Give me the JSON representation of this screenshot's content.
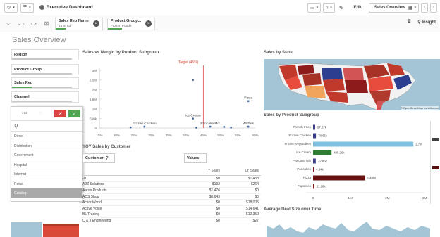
{
  "toolbar": {
    "app_title": "Executive Dashboard",
    "edit_label": "Edit",
    "sheet_selector": "Sales Overview"
  },
  "selections": {
    "chips": [
      {
        "title": "Sales Rep Name",
        "value": "14 of 63"
      },
      {
        "title": "Product Group...",
        "value": "Frozen Foods"
      }
    ],
    "insights_label": "Insight"
  },
  "sheet": {
    "title": "Sales Overview"
  },
  "filters": {
    "region": "Region",
    "product_group": "Product Group",
    "sales_rep": "Sales Rep",
    "channel": "Channel"
  },
  "listbox": {
    "tools_dots": "•••",
    "items": [
      "Direct",
      "Distribution",
      "Government",
      "Hospital",
      "Internet",
      "Retail",
      "Catalog"
    ],
    "selected_index": 6
  },
  "scatter": {
    "title": "Sales vs Margin by Product Subgroup",
    "target_label": "Target (45%)",
    "y_ticks": [
      "3M",
      "2.5M",
      "2M",
      "1.5M",
      "1M",
      "500k",
      "0"
    ],
    "x_ticks": [
      "15%",
      "20%",
      "25%",
      "30%",
      "35%",
      "40%",
      "45%",
      "50%",
      "55%",
      "60%"
    ],
    "labels": [
      "Frozen Chicken",
      "Ice Cream",
      "Pancake Mix",
      "Waffles",
      "Pizza"
    ]
  },
  "yoy": {
    "title": "YOY Sales by Customer",
    "customer_label": "Customer",
    "values_label": "Values",
    "col_ty": "TY Sales",
    "col_ly": "LY Sales",
    "rows": [
      {
        "name": "-D",
        "ty": "$0",
        "ly": "$1,433"
      },
      {
        "name": "A2Z Solutions",
        "ty": "$132",
        "ly": "$264"
      },
      {
        "name": "Aaron Products",
        "ty": "$1,476",
        "ly": "$0"
      },
      {
        "name": "ACS Shop",
        "ty": "$8,643",
        "ly": "$0"
      },
      {
        "name": "ActionWorld",
        "ty": "$0",
        "ly": "$78,005"
      },
      {
        "name": "Active Voice",
        "ty": "$0",
        "ly": "$14,641"
      },
      {
        "name": "BL Trading",
        "ty": "$0",
        "ly": "$12,359"
      },
      {
        "name": "C & J Engineering",
        "ty": "$0",
        "ly": "$27"
      }
    ]
  },
  "map": {
    "title": "Sales by State",
    "attribution": "© OpenStreetMap contributors"
  },
  "subgroup": {
    "title": "Sales by Product Subgroup",
    "x_ticks": [
      "0",
      "1M",
      "2M",
      "3M"
    ]
  },
  "avg_deal": {
    "title": "Average Deal Size over Time"
  },
  "chart_data": [
    {
      "type": "scatter",
      "title": "Sales vs Margin by Product Subgroup",
      "xlabel": "",
      "ylabel": "",
      "xlim": [
        15,
        60
      ],
      "ylim": [
        0,
        3000000
      ],
      "reference_line": {
        "x": 45,
        "label": "Target (45%)"
      },
      "points": [
        {
          "label": "Frozen Chicken",
          "x": 28,
          "y": 70000
        },
        {
          "label": "Ice Cream",
          "x": 42,
          "y": 490000
        },
        {
          "label": "Pancake Mix",
          "x": 47,
          "y": 73000
        },
        {
          "label": "Waffles",
          "x": 58,
          "y": 70000
        },
        {
          "label": "Pizza",
          "x": 58,
          "y": 1400000
        },
        {
          "label": "",
          "x": 42,
          "y": 2500000
        },
        {
          "label": "",
          "x": 51,
          "y": 60000
        },
        {
          "label": "",
          "x": 24,
          "y": 30000
        },
        {
          "label": "",
          "x": 43,
          "y": 20000
        },
        {
          "label": "",
          "x": 53,
          "y": 25000
        }
      ]
    },
    {
      "type": "bar",
      "orientation": "horizontal",
      "title": "Sales by Product Subgroup",
      "categories": [
        "French Fries",
        "Frozen Chicken",
        "Frozen Vegetables",
        "Ice Cream",
        "Pancake Mix",
        "Pancakes",
        "Pizza",
        "Popsicles"
      ],
      "values": [
        57000,
        78000,
        2700000,
        498000,
        73000,
        4340,
        1400000,
        31100
      ],
      "data_labels": [
        "57.57k",
        "78.66k",
        "2.7M",
        "498.26k",
        "72.85k",
        "4.34k",
        "1.40M",
        "31.18k"
      ],
      "colors": [
        "#3e3e8f",
        "#3e3e8f",
        "#7cc2e0",
        "#2e7d32",
        "#3e3e8f",
        "#8b1a1a",
        "#6b1010",
        "#8b1a1a"
      ],
      "xlim": [
        0,
        3000000
      ]
    }
  ]
}
